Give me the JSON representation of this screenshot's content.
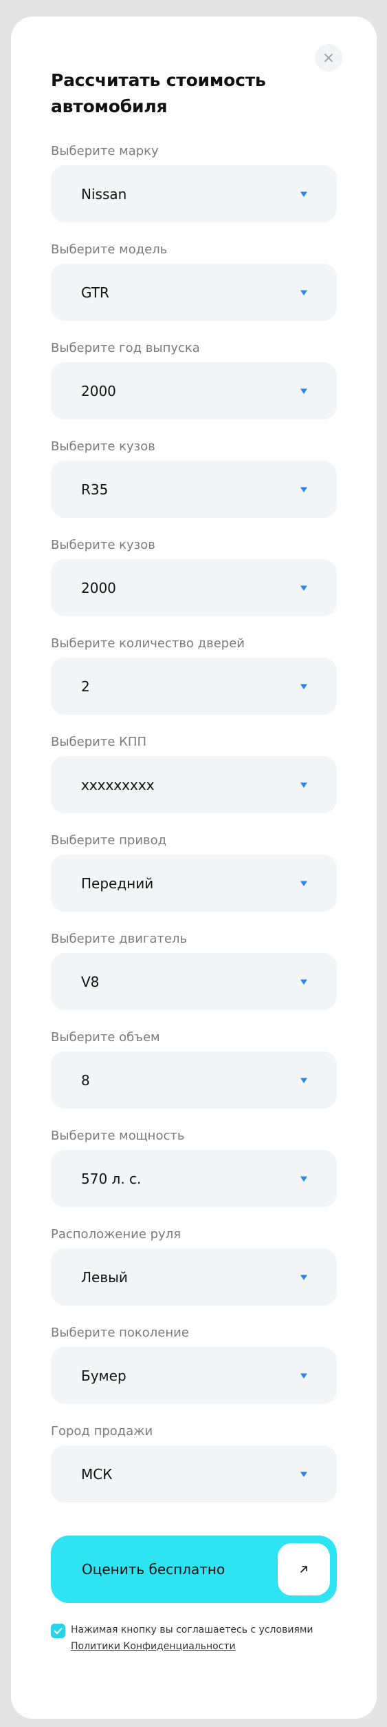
{
  "modal": {
    "title": "Рассчитать стоимость автомобиля",
    "close_icon": "close-icon"
  },
  "fields": [
    {
      "label": "Выберите марку",
      "value": "Nissan"
    },
    {
      "label": "Выберите модель",
      "value": "GTR"
    },
    {
      "label": "Выберите год выпуска",
      "value": "2000"
    },
    {
      "label": "Выберите кузов",
      "value": "R35"
    },
    {
      "label": "Выберите кузов",
      "value": "2000"
    },
    {
      "label": "Выберите количество дверей",
      "value": "2"
    },
    {
      "label": "Выберите КПП",
      "value": "xxxxxxxxx"
    },
    {
      "label": "Выберите привод",
      "value": "Передний"
    },
    {
      "label": "Выберите двигатель",
      "value": "V8"
    },
    {
      "label": "Выберите объем",
      "value": "8"
    },
    {
      "label": "Выберите мощность",
      "value": "570 л. с."
    },
    {
      "label": "Расположение руля",
      "value": "Левый"
    },
    {
      "label": "Выберите поколение",
      "value": "Бумер"
    },
    {
      "label": "Город продажи",
      "value": "МСК"
    }
  ],
  "submit": {
    "label": "Оценить бесплатно",
    "icon": "arrow-up-right-icon"
  },
  "consent": {
    "checked": true,
    "text": "Нажимая кнопку вы соглашаетесь с условиями",
    "link": "Политики Конфиденциальности"
  },
  "colors": {
    "accent": "#2ee3f2",
    "checkbox": "#29d4e9",
    "chevron": "#2b84e8",
    "field_bg": "#f3f4f6",
    "page_bg": "#e4e4e4"
  }
}
